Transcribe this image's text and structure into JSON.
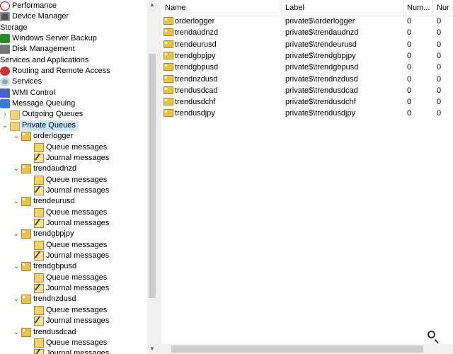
{
  "tree": {
    "top_items": [
      {
        "label": "Performance",
        "icon": "performance-icon"
      },
      {
        "label": "Device Manager",
        "icon": "device-manager-icon"
      },
      {
        "label": "Storage",
        "icon": ""
      },
      {
        "label": "Windows Server Backup",
        "icon": "backup-icon"
      },
      {
        "label": "Disk Management",
        "icon": "disk-icon"
      },
      {
        "label": "Services and Applications",
        "icon": ""
      },
      {
        "label": "Routing and Remote Access",
        "icon": "routing-icon"
      },
      {
        "label": "Services",
        "icon": "services-icon"
      },
      {
        "label": "WMI Control",
        "icon": "wmi-icon"
      },
      {
        "label": "Message Queuing",
        "icon": "message-queuing-icon"
      },
      {
        "label": "Outgoing Queues",
        "icon": "folder-icon"
      },
      {
        "label": "Private Queues",
        "icon": "folder-icon"
      }
    ],
    "queues": [
      "orderlogger",
      "trendaudnzd",
      "trendeurusd",
      "trendgbpjpy",
      "trendgbpusd",
      "trendnzdusd",
      "trendusdcad"
    ],
    "queue_messages_label": "Queue messages",
    "journal_messages_label": "Journal messages",
    "selected": "Private Queues"
  },
  "list": {
    "columns": [
      "Name",
      "Label",
      "Num...",
      "Nur"
    ],
    "rows": [
      {
        "name": "orderlogger",
        "label": "private$\\orderlogger",
        "num1": "0",
        "num2": "0"
      },
      {
        "name": "trendaudnzd",
        "label": "private$\\trendaudnzd",
        "num1": "0",
        "num2": "0"
      },
      {
        "name": "trendeurusd",
        "label": "private$\\trendeurusd",
        "num1": "0",
        "num2": "0"
      },
      {
        "name": "trendgbpjpy",
        "label": "private$\\trendgbpjpy",
        "num1": "0",
        "num2": "0"
      },
      {
        "name": "trendgbpusd",
        "label": "private$\\trendgbpusd",
        "num1": "0",
        "num2": "0"
      },
      {
        "name": "trendnzdusd",
        "label": "private$\\trendnzdusd",
        "num1": "0",
        "num2": "0"
      },
      {
        "name": "trendusdcad",
        "label": "private$\\trendusdcad",
        "num1": "0",
        "num2": "0"
      },
      {
        "name": "trendusdchf",
        "label": "private$\\trendusdchf",
        "num1": "0",
        "num2": "0"
      },
      {
        "name": "trendusdjpy",
        "label": "private$\\trendusdjpy",
        "num1": "0",
        "num2": "0"
      }
    ]
  }
}
